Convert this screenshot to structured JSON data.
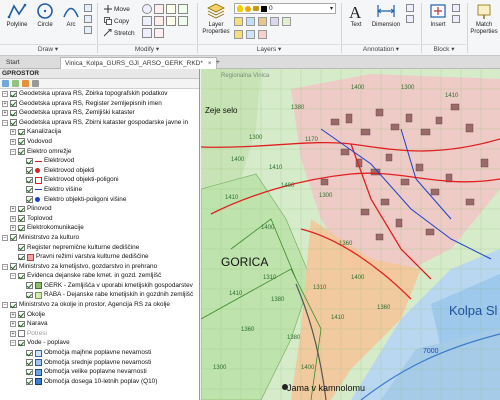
{
  "ribbon": {
    "draw_tools": [
      {
        "label": "Polyline",
        "icon": "polyline-icon"
      },
      {
        "label": "Circle",
        "icon": "circle-icon"
      },
      {
        "label": "Arc",
        "icon": "arc-icon"
      }
    ],
    "modify_tools": [
      {
        "label": "Move",
        "icon": "move-icon"
      },
      {
        "label": "Copy",
        "icon": "copy-icon"
      },
      {
        "label": "Stretch",
        "icon": "stretch-icon"
      }
    ],
    "layer_properties_label": "Layer Properties",
    "current_layer": "0",
    "text_label": "Text",
    "dimension_label": "Dimension",
    "insert_label": "Insert",
    "match_label": "Match Properties",
    "panels": {
      "draw": "Draw ▾",
      "modify": "Modify ▾",
      "layers": "Layers ▾",
      "annotation": "Annotation ▾",
      "block": "Block ▾"
    }
  },
  "tabs": {
    "start": "Start",
    "document": "Vinica_Kolpa_GURS_GJI_ARSO_GERK_RKD*",
    "close": "×",
    "add": "+"
  },
  "panel": {
    "title": "GPROSTOR",
    "rows": [
      {
        "level": 0,
        "exp": "–",
        "cb": true,
        "sym": "",
        "text": "Geodetska uprava RS, Zbirka topografskih podatkov"
      },
      {
        "level": 0,
        "exp": "+",
        "cb": true,
        "sym": "",
        "text": "Geodetska uprava RS, Register zemljepisnih imen"
      },
      {
        "level": 0,
        "exp": "+",
        "cb": true,
        "sym": "",
        "text": "Geodetska uprava RS, Zemljiški kataster"
      },
      {
        "level": 0,
        "exp": "–",
        "cb": true,
        "sym": "",
        "text": "Geodetska uprava RS, Zbirni kataster gospodarske javne in"
      },
      {
        "level": 1,
        "exp": "+",
        "cb": true,
        "sym": "",
        "text": "Kanalizacija"
      },
      {
        "level": 1,
        "exp": "+",
        "cb": true,
        "sym": "",
        "text": "Vodovod"
      },
      {
        "level": 1,
        "exp": "–",
        "cb": true,
        "sym": "",
        "text": "Elektro omrežje"
      },
      {
        "level": 2,
        "exp": "",
        "cb": true,
        "sym": "line-red",
        "text": "Elektrovod"
      },
      {
        "level": 2,
        "exp": "",
        "cb": true,
        "sym": "dot-red",
        "text": "Elektrovod objekti"
      },
      {
        "level": 2,
        "exp": "",
        "cb": true,
        "sym": "sq-red",
        "text": "Elektrovod objekti-poligoni"
      },
      {
        "level": 2,
        "exp": "",
        "cb": true,
        "sym": "line-blue",
        "text": "Elektro višine"
      },
      {
        "level": 2,
        "exp": "",
        "cb": true,
        "sym": "dot-blue",
        "text": "Elektro objekti-poligoni višine"
      },
      {
        "level": 1,
        "exp": "+",
        "cb": true,
        "sym": "",
        "text": "Plinovod"
      },
      {
        "level": 1,
        "exp": "+",
        "cb": true,
        "sym": "",
        "text": "Toplovod"
      },
      {
        "level": 1,
        "exp": "+",
        "cb": true,
        "sym": "",
        "text": "Elektrokomunikacije"
      },
      {
        "level": 0,
        "exp": "–",
        "cb": true,
        "sym": "",
        "text": "Ministrstvo za kulturo"
      },
      {
        "level": 1,
        "exp": "",
        "cb": true,
        "sym": "",
        "text": "Register nepremične kulturne dediščine"
      },
      {
        "level": 1,
        "exp": "",
        "cb": true,
        "sym": "sq-pink",
        "text": "Pravni režimi varstva kulturne dediščine"
      },
      {
        "level": 0,
        "exp": "–",
        "cb": true,
        "sym": "",
        "text": "Ministrstvo za kmetijstvo, gozdarstvo in prehrano"
      },
      {
        "level": 1,
        "exp": "–",
        "cb": true,
        "sym": "",
        "text": "Evidenca dejanske rabe kmet. in gozd. zemljišč"
      },
      {
        "level": 2,
        "exp": "",
        "cb": true,
        "sym": "sq-green",
        "text": "GERK - Zemljišča v uporabi kmetijskih gospodarstev"
      },
      {
        "level": 2,
        "exp": "",
        "cb": true,
        "sym": "sq-ltgreen",
        "text": "RABA - Dejanske rabe kmetijskih in gozdnih zemljišč"
      },
      {
        "level": 0,
        "exp": "–",
        "cb": true,
        "sym": "",
        "text": "Ministrstvo za okolje in prostor, Agencija RS za okolje"
      },
      {
        "level": 1,
        "exp": "+",
        "cb": true,
        "sym": "",
        "text": "Okolje"
      },
      {
        "level": 1,
        "exp": "+",
        "cb": true,
        "sym": "",
        "text": "Narava"
      },
      {
        "level": 1,
        "exp": "+",
        "cb": false,
        "sym": "",
        "text": "Potresi",
        "dim": true
      },
      {
        "level": 1,
        "exp": "–",
        "cb": true,
        "sym": "",
        "text": "Vode - poplave"
      },
      {
        "level": 2,
        "exp": "",
        "cb": true,
        "sym": "sq-blue1",
        "text": "Območja majhne poplavne nevarnosti"
      },
      {
        "level": 2,
        "exp": "",
        "cb": true,
        "sym": "sq-blue2",
        "text": "Območja srednje poplavne nevarnosti"
      },
      {
        "level": 2,
        "exp": "",
        "cb": true,
        "sym": "sq-blue3",
        "text": "Območja velike poplavne nevarnosti"
      },
      {
        "level": 2,
        "exp": "",
        "cb": true,
        "sym": "sq-blue4",
        "text": "Območja dosega 10-letnih poplav (Q10)"
      }
    ]
  },
  "map": {
    "labels": {
      "village": "Zeje selo",
      "gorica": "GORICA",
      "river": "Kolpa Sl",
      "quarry": "Jama v kamnolomu",
      "route": "7000",
      "faint": "Regionalna Vinica"
    },
    "parcel_numbers": [
      "1400",
      "1410",
      "1300",
      "1170",
      "1400",
      "1300",
      "1400",
      "1360",
      "1410",
      "1380",
      "1310",
      "1360",
      "1380",
      "1400",
      "1410",
      "1300",
      "1400",
      "1360",
      "1310",
      "1410",
      "1380",
      "1400",
      "1300",
      "1410"
    ]
  }
}
